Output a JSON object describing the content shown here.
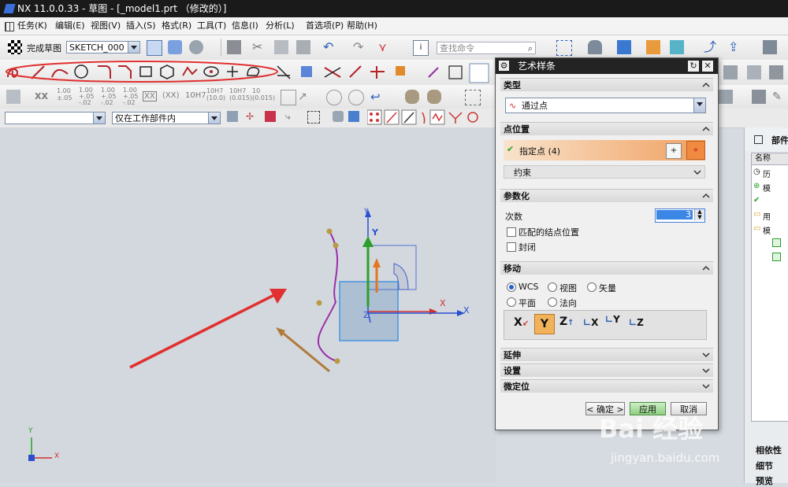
{
  "title_bar": {
    "text": "NX 11.0.0.33 - 草图 - [_model1.prt （修改的）]"
  },
  "menu": {
    "items": [
      "任务(K)",
      "编辑(E)",
      "视图(V)",
      "插入(S)",
      "格式(R)",
      "工具(T)",
      "信息(I)",
      "分析(L)",
      "首选项(P)",
      "帮助(H)"
    ]
  },
  "toolbar": {
    "finish_sketch": "完成草图",
    "sketch_name": "SKETCH_000",
    "search_placeholder": "查找命令",
    "scope_filter": "仅在工作部件内",
    "dim_labels": [
      "XX",
      "1.00 ±.05",
      "1.00 +.05 -.02",
      "1.00 +.05 -.02",
      "1.00 +.05 -.02",
      "XX",
      "(XX)",
      "10H7",
      "10H7 (10.0)",
      "10H7 (0.015)",
      "10 (0.015)"
    ]
  },
  "dialog": {
    "title": "艺术样条",
    "type_section": "类型",
    "type_value": "通过点",
    "point_section": "点位置",
    "specify_point": "指定点 (4)",
    "constraint": "约束",
    "param_section": "参数化",
    "degree_label": "次数",
    "degree_value": "3",
    "match_knot": "匹配的结点位置",
    "closed": "封闭",
    "move_section": "移动",
    "move_options": [
      "WCS",
      "视图",
      "矢量",
      "平面",
      "法向"
    ],
    "axis_labels": [
      "X",
      "Y",
      "Z",
      "X",
      "Y",
      "Z"
    ],
    "extend_section": "延伸",
    "settings_section": "设置",
    "fine_section": "微定位",
    "ok": "< 确定 >",
    "apply": "应用",
    "cancel": "取消"
  },
  "viewport": {
    "axis_y": "Y",
    "axis_x": "X",
    "axis_z": "Z",
    "csys_x": "X",
    "csys_y": "Y"
  },
  "right_panel": {
    "header": "部件",
    "column": "名称",
    "rows": [
      "历",
      "模",
      "",
      "用",
      "模"
    ],
    "bottom_tabs": [
      "相依性",
      "细节",
      "预览"
    ]
  },
  "watermark": {
    "line1": "Bai 经验",
    "line2": "jingyan.baidu.com"
  },
  "colors": {
    "title_bg": "#1a1a1a",
    "highlight_orange": "#f0a060",
    "annotation_red": "#e03030",
    "spline_purple": "#8a2a9a"
  }
}
